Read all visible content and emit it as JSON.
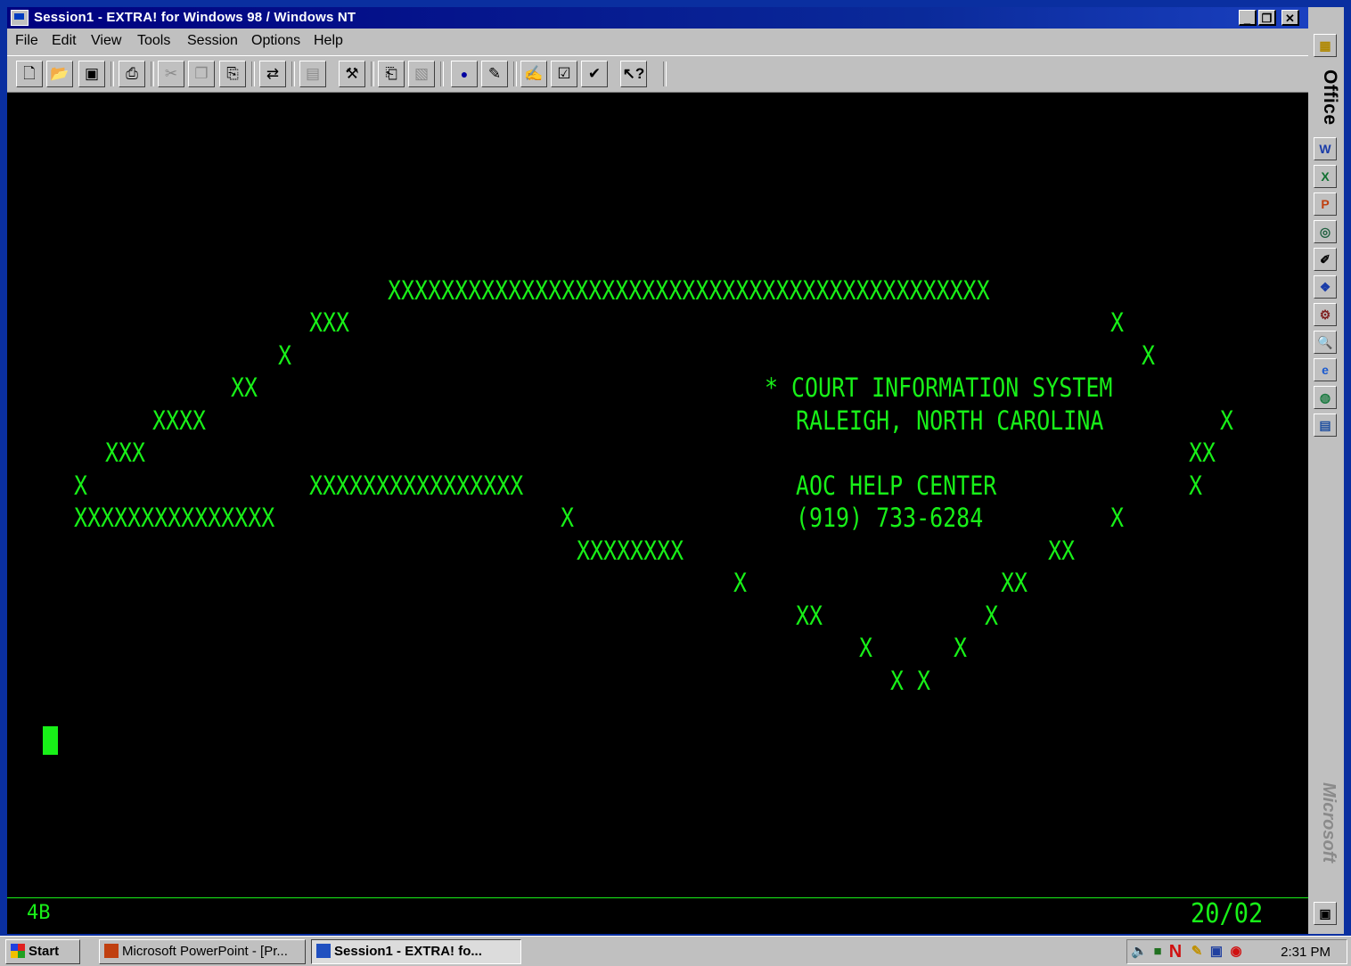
{
  "window": {
    "title": "Session1 - EXTRA! for Windows 98 / Windows NT"
  },
  "menu": [
    "File",
    "Edit",
    "View",
    "Tools",
    "Session",
    "Options",
    "Help"
  ],
  "toolbar": {
    "icons": [
      "new-icon",
      "open-icon",
      "save-icon",
      "print-icon",
      "cut-icon",
      "copy-icon",
      "paste-icon",
      "connect-icon",
      "send-icon",
      "tools-icon",
      "transfer-icon",
      "receive-icon",
      "record-icon",
      "macro-icon",
      "edit-icon",
      "edit-2-icon",
      "check-icon",
      "help-icon"
    ]
  },
  "terminal": {
    "lines": [
      {
        "text": "XXXXXXXXXXXXXXXXXXXXXXXXXXXXXXXXXXXXXXXXXXXXX"
      },
      {
        "text": "XXX"
      },
      {
        "text": "X"
      },
      {
        "text": "X"
      },
      {
        "text": "X"
      },
      {
        "text": "XX"
      },
      {
        "text": "* COURT INFORMATION SYSTEM"
      },
      {
        "text": "XXXX"
      },
      {
        "text": "RALEIGH, NORTH CAROLINA"
      },
      {
        "text": "X"
      },
      {
        "text": "XXX"
      },
      {
        "text": "XX"
      },
      {
        "text": "X"
      },
      {
        "text": "XXXXXXXXXXXXXXXX"
      },
      {
        "text": "AOC HELP CENTER"
      },
      {
        "text": "X"
      },
      {
        "text": "XXXXXXXXXXXXXXX"
      },
      {
        "text": "X"
      },
      {
        "text": "(919) 733-6284"
      },
      {
        "text": "X"
      },
      {
        "text": "XXXXXXXX"
      },
      {
        "text": "XX"
      },
      {
        "text": "X"
      },
      {
        "text": "XX"
      },
      {
        "text": "XX"
      },
      {
        "text": "X"
      },
      {
        "text": "X"
      },
      {
        "text": "X"
      },
      {
        "text": "X X"
      }
    ],
    "status_left": "4B",
    "status_right": "20/02"
  },
  "office_bar": {
    "label": "Office",
    "brand": "Microsoft"
  },
  "taskbar": {
    "start": "Start",
    "tasks": [
      "Microsoft PowerPoint - [Pr...",
      "Session1 - EXTRA! fo..."
    ],
    "clock": "2:31 PM"
  }
}
